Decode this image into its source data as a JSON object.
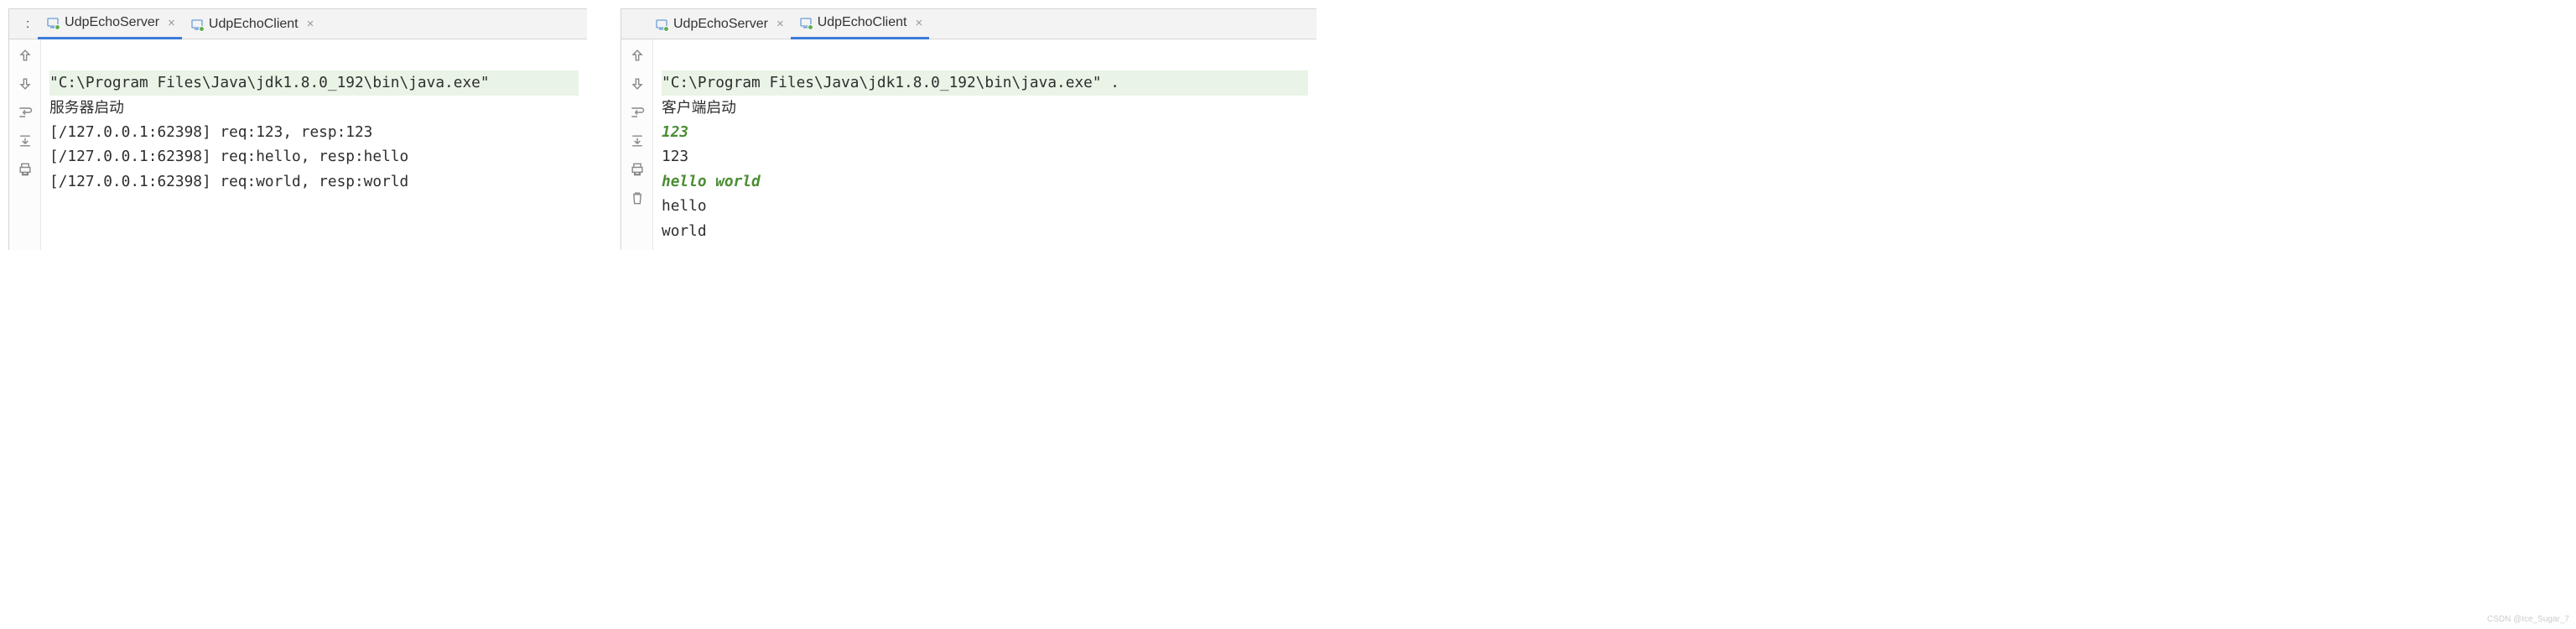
{
  "watermark": "CSDN @Ice_Sugar_7",
  "left": {
    "prefix": ":",
    "tabs": [
      {
        "label": "UdpEchoServer",
        "active": true
      },
      {
        "label": "UdpEchoClient",
        "active": false
      }
    ],
    "lines": [
      {
        "text": "\"C:\\Program Files\\Java\\jdk1.8.0_192\\bin\\java.exe\"",
        "cls": "hl"
      },
      {
        "text": "服务器启动",
        "cls": ""
      },
      {
        "text": "[/127.0.0.1:62398] req:123, resp:123",
        "cls": ""
      },
      {
        "text": "[/127.0.0.1:62398] req:hello, resp:hello",
        "cls": ""
      },
      {
        "text": "[/127.0.0.1:62398] req:world, resp:world",
        "cls": ""
      }
    ]
  },
  "right": {
    "tabs": [
      {
        "label": "UdpEchoServer",
        "active": false
      },
      {
        "label": "UdpEchoClient",
        "active": true
      }
    ],
    "lines": [
      {
        "text": "\"C:\\Program Files\\Java\\jdk1.8.0_192\\bin\\java.exe\" .",
        "cls": "hl"
      },
      {
        "text": "客户端启动",
        "cls": ""
      },
      {
        "text": "123",
        "cls": "green-input"
      },
      {
        "text": "123",
        "cls": ""
      },
      {
        "text": "hello world",
        "cls": "green-input"
      },
      {
        "text": "hello",
        "cls": ""
      },
      {
        "text": "world",
        "cls": ""
      }
    ]
  },
  "gutter_icons": [
    "arrow-up",
    "arrow-down",
    "wrap",
    "scroll-end",
    "print",
    "trash"
  ]
}
